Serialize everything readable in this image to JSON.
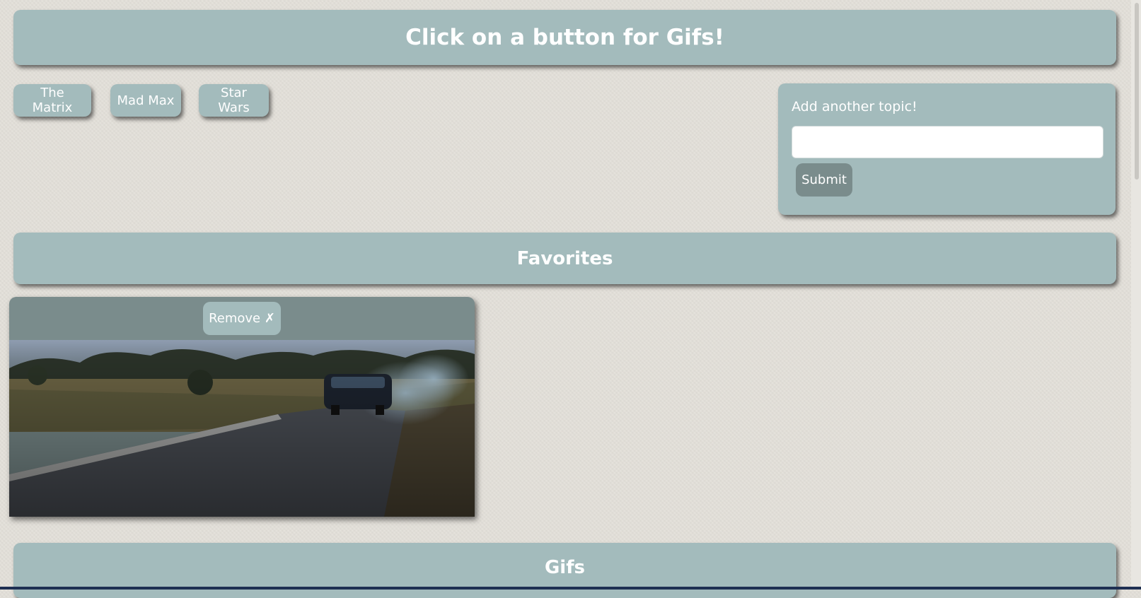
{
  "header": {
    "title": "Click on a button for Gifs!"
  },
  "topics": [
    {
      "label": "The Matrix"
    },
    {
      "label": "Mad Max"
    },
    {
      "label": "Star Wars"
    }
  ],
  "add_topic_form": {
    "label": "Add another topic!",
    "input_value": "",
    "submit_label": "Submit"
  },
  "favorites": {
    "title": "Favorites",
    "items": [
      {
        "remove_label": "Remove ✗",
        "image": "car-doing-burnout-on-country-road"
      }
    ]
  },
  "gifs": {
    "title": "Gifs"
  },
  "colors": {
    "panel": "#a3bbbc",
    "dark_panel": "#7a8c8c",
    "background": "#e4e1da",
    "text": "#ffffff"
  }
}
